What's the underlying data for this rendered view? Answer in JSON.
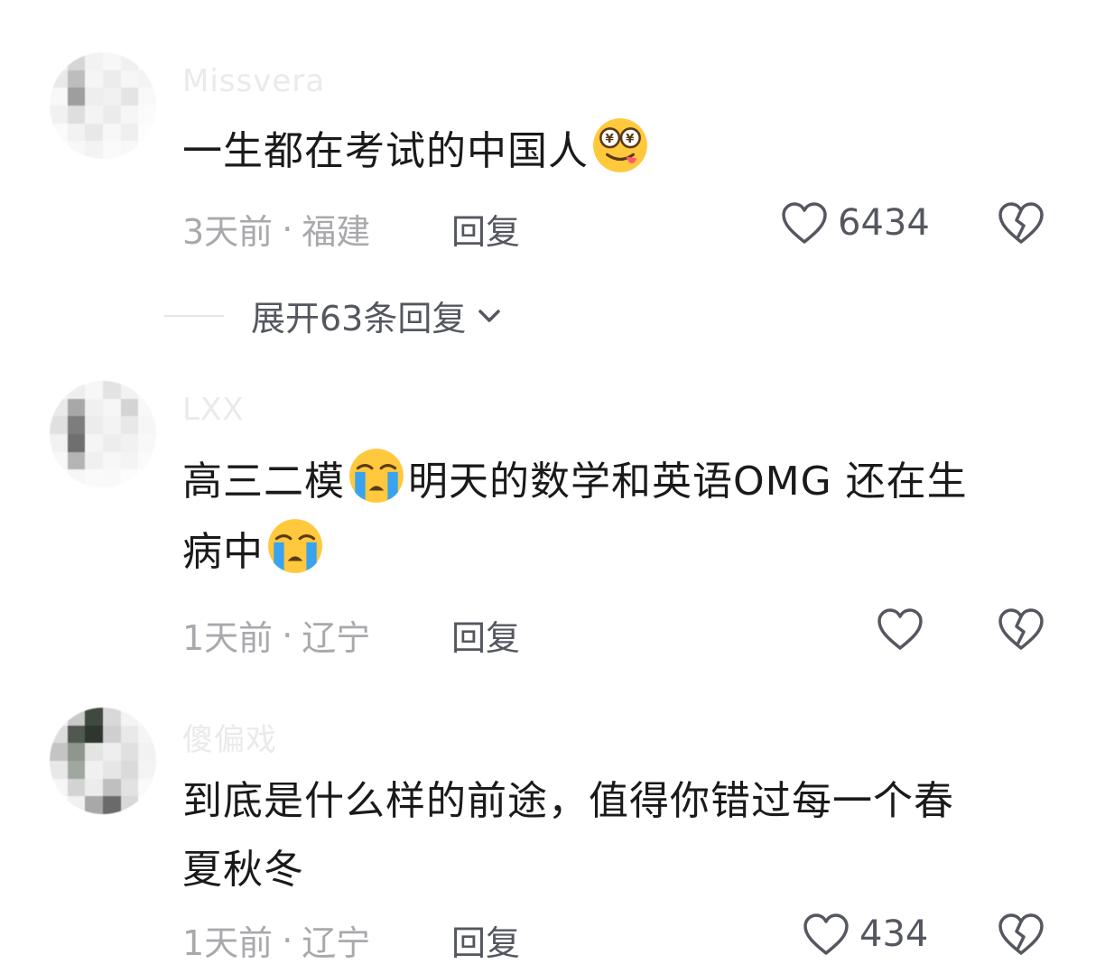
{
  "comments": [
    {
      "username": "Missvera",
      "text_before": "一生都在考试的中国人",
      "emoji1": "drooling-money-face-emoji",
      "time": "3天前",
      "dot": "·",
      "location": "福建",
      "reply": "回复",
      "likes": "6434"
    },
    {
      "username": "LXX",
      "text_part1": "高三二模",
      "emoji1": "loudly-crying-face-emoji",
      "text_part2": "明天的数学和英语OMG 还在生",
      "text_part3": "病中",
      "emoji2": "loudly-crying-face-emoji",
      "time": "1天前",
      "dot": "·",
      "location": "辽宁",
      "reply": "回复",
      "likes": ""
    },
    {
      "username": "傻偏戏",
      "text_line1": "到底是什么样的前途，值得你错过每一个春",
      "text_line2": "夏秋冬",
      "time": "1天前",
      "dot": "·",
      "location": "辽宁",
      "reply": "回复",
      "likes": "434"
    }
  ],
  "expand_replies": "展开63条回复",
  "icons": {
    "like": "heart-outline-icon",
    "dislike": "broken-heart-icon",
    "expand": "chevron-down-icon"
  },
  "colors": {
    "text": "#1a1a1a",
    "meta": "#a9a9ad",
    "action": "#555760",
    "emoji_yellow": "#ffc83d",
    "tear_blue": "#3aa3f0"
  }
}
